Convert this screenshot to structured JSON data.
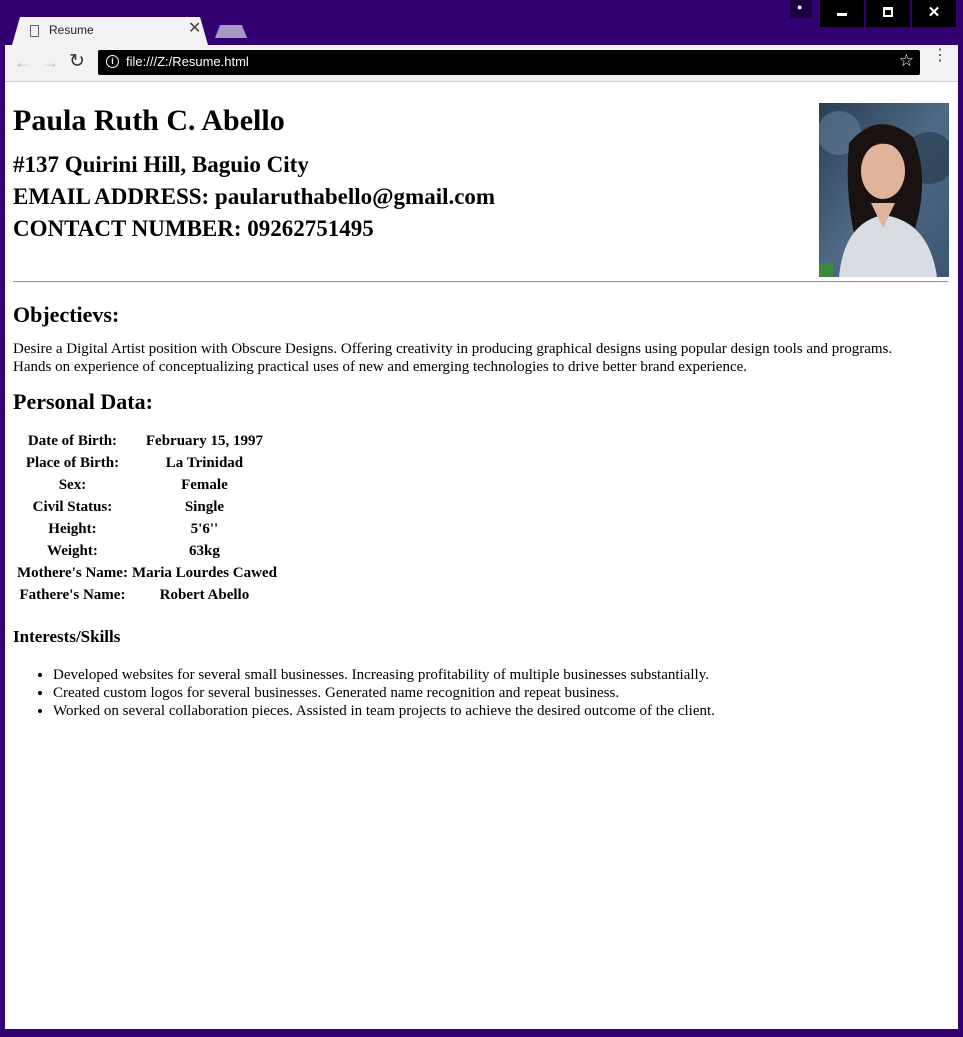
{
  "browser": {
    "tab_title": "Resume",
    "tab_close": "✕",
    "url": "file:///Z:/Resume.html",
    "icons": {
      "back": "←",
      "forward": "→",
      "reload": "↻",
      "star": "☆",
      "menu": "⋮",
      "info": "i",
      "close": "✕",
      "user": "👤"
    }
  },
  "resume": {
    "name": "Paula Ruth C. Abello",
    "address": "#137 Quirini Hill, Baguio City",
    "email": "EMAIL ADDRESS: paularuthabello@gmail.com",
    "contact": "CONTACT NUMBER: 09262751495",
    "objectives_heading": "Objectievs:",
    "objectives_text": "Desire a Digital Artist position with Obscure Designs. Offering creativity in producing graphical designs using popular design tools and programs. Hands on experience of conceptualizing practical uses of new and emerging technologies to drive better brand experience.",
    "personal_heading": "Personal Data:",
    "personal_rows": [
      {
        "label": "Date of Birth:",
        "value": "February 15, 1997"
      },
      {
        "label": "Place of Birth:",
        "value": "La Trinidad"
      },
      {
        "label": "Sex:",
        "value": "Female"
      },
      {
        "label": "Civil Status:",
        "value": "Single"
      },
      {
        "label": "Height:",
        "value": "5'6''"
      },
      {
        "label": "Weight:",
        "value": "63kg"
      },
      {
        "label": "Mothere's Name:",
        "value": "Maria Lourdes Cawed"
      },
      {
        "label": "Fathere's Name:",
        "value": "Robert Abello"
      }
    ],
    "skills_heading": "Interests/Skills",
    "skills": [
      "Developed websites for several small businesses. Increasing profitability of multiple businesses substantially.",
      "Created custom logos for several businesses. Generated name recognition and repeat business.",
      "Worked on several collaboration pieces. Assisted in team projects to achieve the desired outcome of the client."
    ]
  },
  "colors": {
    "window_frame": "#330072",
    "omnibox": "#000000",
    "tab": "#f2f2f2"
  }
}
